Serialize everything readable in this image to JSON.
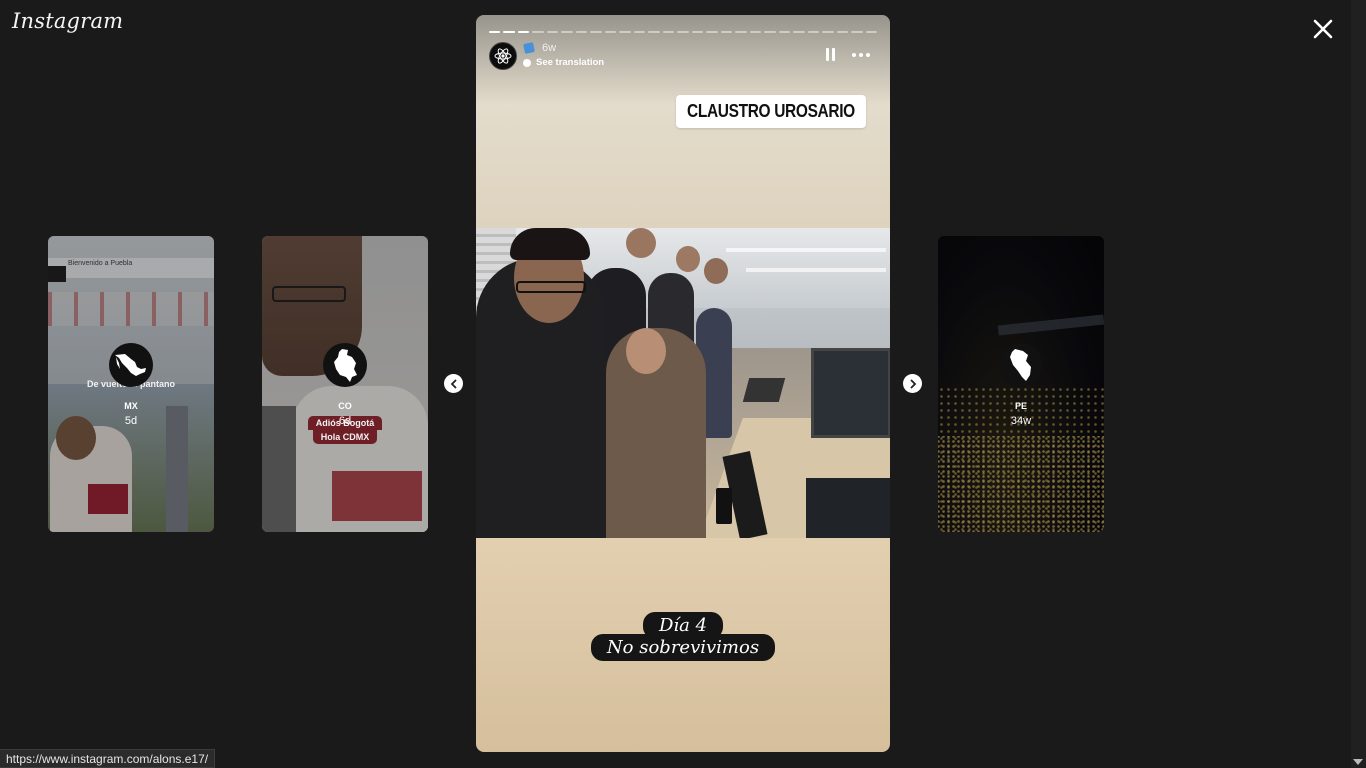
{
  "app": {
    "logo_text": "Instagram"
  },
  "window": {
    "close_icon": "close-icon"
  },
  "stories_left": [
    {
      "name": "MX",
      "time": "5d",
      "caption": "De vuelto al pantano",
      "sign_text": "Bienvenido a Puebla"
    },
    {
      "name": "CO",
      "time": "6d",
      "caption_line1": "Adiós Bogotá",
      "caption_line2": "Hola CDMX"
    }
  ],
  "stories_right": [
    {
      "name": "PE",
      "time": "34w"
    }
  ],
  "active_story": {
    "time": "6w",
    "see_translation": "See translation",
    "location": "CLAUSTRO UROSARIO",
    "caption_line1": "Día 4",
    "caption_line2": "No sobrevivimos",
    "progress_total": 27,
    "progress_done": 3
  },
  "status_bar": {
    "url": "https://www.instagram.com/alons.e17/"
  },
  "colors": {
    "background": "#1a1a1a",
    "accent_pin": "#dd2a7b"
  }
}
